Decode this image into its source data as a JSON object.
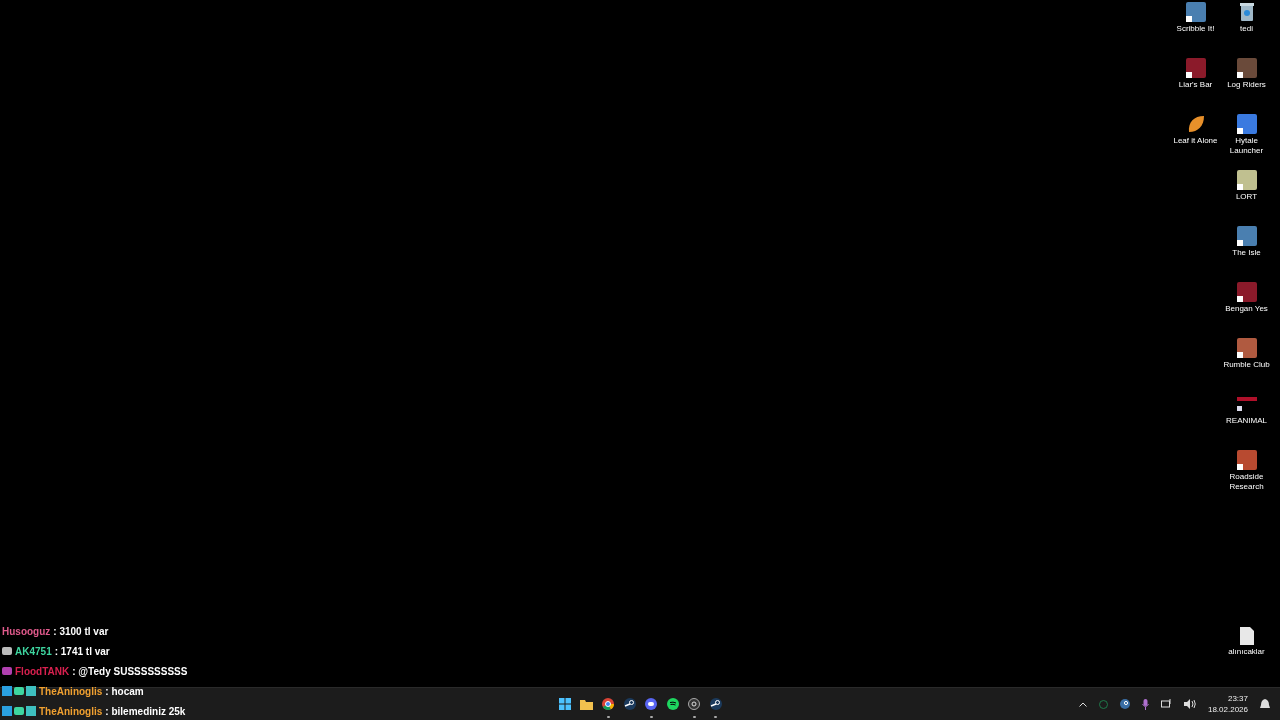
{
  "desktop": {
    "columns": [
      [
        {
          "label": "Scribble It!",
          "kind": "game"
        },
        {
          "label": "Liar's Bar",
          "kind": "game"
        },
        {
          "label": "Leaf it Alone",
          "kind": "leaf"
        }
      ],
      [
        {
          "label": "tedi",
          "kind": "bin"
        },
        {
          "label": "Log Riders",
          "kind": "game"
        },
        {
          "label": "Hytale Launcher",
          "kind": "game"
        },
        {
          "label": "LORT",
          "kind": "game"
        },
        {
          "label": "The Isle",
          "kind": "game"
        },
        {
          "label": "Bengan Yes",
          "kind": "game"
        },
        {
          "label": "Rumble Club",
          "kind": "game"
        },
        {
          "label": "REANIMAL",
          "kind": "banner"
        },
        {
          "label": "Roadside Research",
          "kind": "game"
        }
      ]
    ],
    "bottom_icon": {
      "label": "alınıcaklar",
      "kind": "document"
    }
  },
  "chat": [
    {
      "user": "Husooguz",
      "color": "#e05a8c",
      "text": ": 3100 tl var",
      "kind": "none"
    },
    {
      "user": "AK4751",
      "color": "#3ed6a0",
      "text": ": 1741 tl var",
      "kind": "grey"
    },
    {
      "user": "FloodTANK",
      "color": "#d9204f",
      "text": ": @Tedy SUSSSSSSSSS",
      "kind": "purple"
    },
    {
      "user": "TheAninoglis",
      "color": "#f0a030",
      "text": ": hocam",
      "kind": "set"
    },
    {
      "user": "TheAninoglis",
      "color": "#f0a030",
      "text": ": bilemediniz 25k",
      "kind": "set"
    }
  ],
  "taskbar": {
    "apps": [
      {
        "kind": "start",
        "running": false
      },
      {
        "kind": "folder",
        "running": false
      },
      {
        "kind": "browser",
        "running": true
      },
      {
        "kind": "steam",
        "running": false
      },
      {
        "kind": "chat",
        "running": true
      },
      {
        "kind": "music",
        "running": false
      },
      {
        "kind": "record",
        "running": true
      },
      {
        "kind": "steam",
        "running": true
      }
    ],
    "time": "23:37",
    "date": "18.02.2026"
  }
}
